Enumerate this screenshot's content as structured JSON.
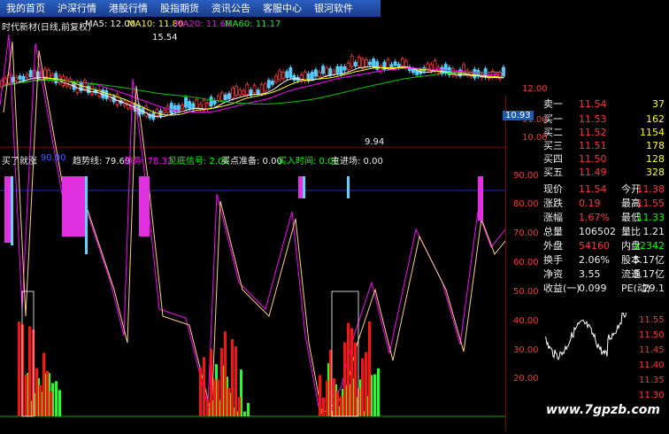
{
  "menu": [
    "我的首页",
    "沪深行情",
    "港股行情",
    "股指期货",
    "资讯公告",
    "客服中心",
    "银河软件"
  ],
  "stock": {
    "title": "时代新材(日线,前复权)",
    "ma5": "MA5: 12.00",
    "ma10": "MA10: 11.80",
    "ma20": "MA20: 11.68",
    "ma60": "MA60: 11.17",
    "high": "15.54",
    "low": "9.94",
    "last_price_tag": "10.93",
    "price_axis": [
      "12.00",
      "11.00",
      "10.00"
    ]
  },
  "indicator": {
    "name": "买了就涨",
    "v1": "90.00",
    "trend_label": "趋势线: 79.69",
    "trend2_label": "趋势: 78.32",
    "bottom_label": "见底信号: 2.00",
    "buy_ready_label": "买点准备: 0.00",
    "buy_time_label": "买入时间: 0.00",
    "main_label": "主进场: 0.00",
    "axis": [
      "90.00",
      "80.00",
      "70.00",
      "60.00",
      "50.00",
      "40.00",
      "30.00",
      "20.00"
    ]
  },
  "quotes": {
    "sell": [
      {
        "label": "卖一",
        "price": "11.54",
        "vol": "37"
      }
    ],
    "buy": [
      {
        "label": "买一",
        "price": "11.53",
        "vol": "162"
      },
      {
        "label": "买二",
        "price": "11.52",
        "vol": "1154"
      },
      {
        "label": "买三",
        "price": "11.51",
        "vol": "178"
      },
      {
        "label": "买四",
        "price": "11.50",
        "vol": "128"
      },
      {
        "label": "买五",
        "price": "11.49",
        "vol": "328"
      }
    ],
    "stats": [
      {
        "k1": "现价",
        "v1": "11.54",
        "k2": "今开",
        "v2": "11.38"
      },
      {
        "k1": "涨跌",
        "v1": "0.19",
        "k2": "最高",
        "v2": "11.55"
      },
      {
        "k1": "涨幅",
        "v1": "1.67%",
        "k2": "最低",
        "v2": "11.33"
      },
      {
        "k1": "总量",
        "v1": "106502",
        "k2": "量比",
        "v2": "1.21"
      },
      {
        "k1": "外盘",
        "v1": "54160",
        "k2": "内盘",
        "v2": "52342"
      },
      {
        "k1": "换手",
        "v1": "2.06%",
        "k2": "股本",
        "v2": "5.17亿"
      },
      {
        "k1": "净资",
        "v1": "3.55",
        "k2": "流通",
        "v2": "5.17亿"
      },
      {
        "k1": "收益(一)",
        "v1": "0.099",
        "k2": "PE(动)",
        "v2": "29.1"
      }
    ],
    "mini_axis": [
      "11.55",
      "11.50",
      "11.45",
      "11.40",
      "11.35",
      "11.30"
    ]
  },
  "watermark": "www.7gpzb.com"
}
